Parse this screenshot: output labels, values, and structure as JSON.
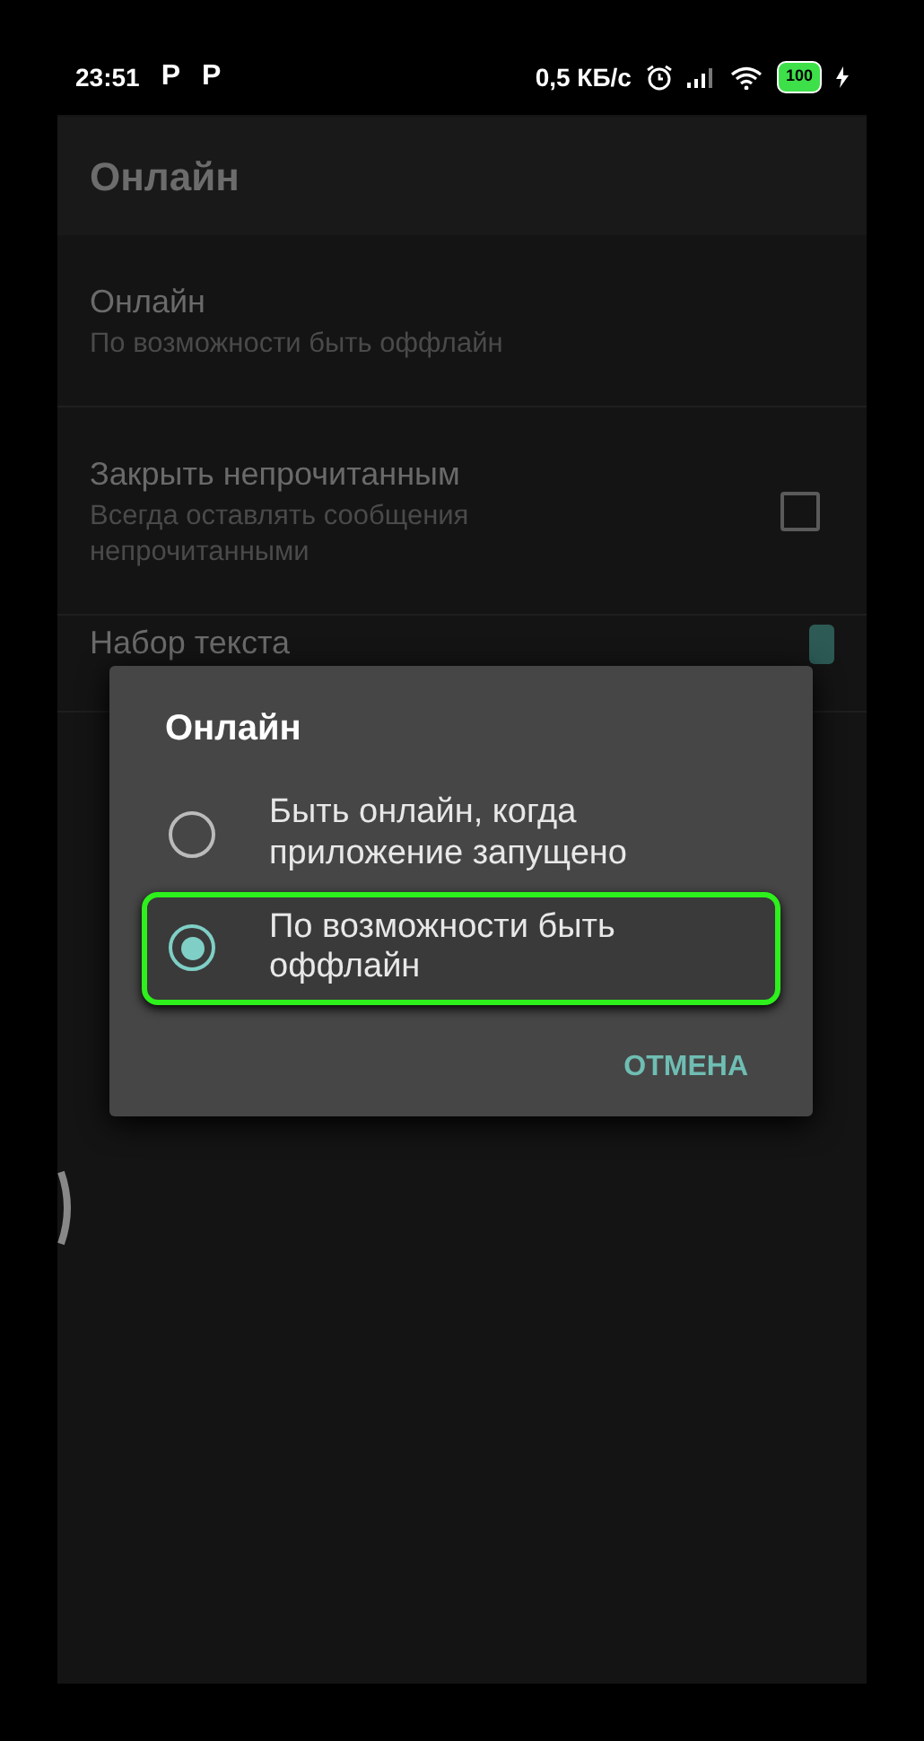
{
  "status_bar": {
    "time": "23:51",
    "notification_icons": [
      "P",
      "P"
    ],
    "speed": "0,5 КБ/с",
    "battery": "100",
    "charging": true
  },
  "app_bar": {
    "title": "Онлайн"
  },
  "settings": [
    {
      "kind": "text",
      "title": "Онлайн",
      "summary": "По возможности быть оффлайн"
    },
    {
      "kind": "checkbox",
      "title": "Закрыть непрочитанным",
      "summary": "Всегда оставлять сообщения непрочитанными",
      "checked": false
    },
    {
      "kind": "switch",
      "title": "Набор текста",
      "on": true
    }
  ],
  "dialog": {
    "title": "Онлайн",
    "options": [
      {
        "label": "Быть онлайн, когда приложение запущено",
        "selected": false
      },
      {
        "label": "По возможности быть оффлайн",
        "selected": true
      }
    ],
    "button": "ОТМЕНА"
  }
}
